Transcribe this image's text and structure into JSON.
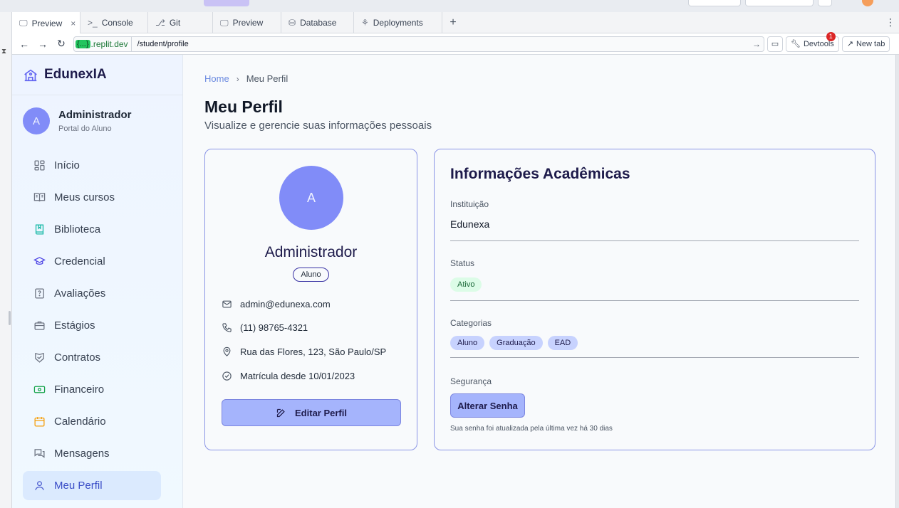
{
  "browser": {
    "tabs": [
      {
        "label": "Preview",
        "icon": "monitor-icon",
        "active": true
      },
      {
        "label": "Console",
        "icon": "terminal-icon"
      },
      {
        "label": "Git",
        "icon": "git-icon"
      },
      {
        "label": "Preview",
        "icon": "monitor-icon"
      },
      {
        "label": "Database",
        "icon": "database-icon"
      },
      {
        "label": "Deployments",
        "icon": "deploy-icon"
      }
    ],
    "host_badge": "{...}",
    "host": ".replit.dev",
    "path": "/student/profile",
    "devtools_label": "Devtools",
    "devtools_count": "1",
    "newtab_label": "New tab"
  },
  "sidebar": {
    "brand": "EdunexIA",
    "user": {
      "initial": "A",
      "name": "Administrador",
      "role": "Portal do Aluno"
    },
    "items": [
      {
        "label": "Início",
        "icon": "grid-icon",
        "color": "#6b7280"
      },
      {
        "label": "Meus cursos",
        "icon": "book-open-icon",
        "color": "#6b7280"
      },
      {
        "label": "Biblioteca",
        "icon": "bookmark-book-icon",
        "color": "#14b8a6"
      },
      {
        "label": "Credencial",
        "icon": "graduation-cap-icon",
        "color": "#4f46e5"
      },
      {
        "label": "Avaliações",
        "icon": "question-file-icon",
        "color": "#6b7280"
      },
      {
        "label": "Estágios",
        "icon": "briefcase-icon",
        "color": "#6b7280"
      },
      {
        "label": "Contratos",
        "icon": "handshake-icon",
        "color": "#6b7280"
      },
      {
        "label": "Financeiro",
        "icon": "banknote-icon",
        "color": "#16a34a"
      },
      {
        "label": "Calendário",
        "icon": "calendar-icon",
        "color": "#f59e0b"
      },
      {
        "label": "Mensagens",
        "icon": "messages-icon",
        "color": "#6b7280"
      },
      {
        "label": "Meu Perfil",
        "icon": "user-icon",
        "color": "#3b4ec7",
        "active": true
      }
    ]
  },
  "main": {
    "breadcrumb": {
      "home": "Home",
      "current": "Meu Perfil"
    },
    "title": "Meu Perfil",
    "subtitle": "Visualize e gerencie suas informações pessoais",
    "profile": {
      "initial": "A",
      "name": "Administrador",
      "role": "Aluno",
      "email": "admin@edunexa.com",
      "phone": "(11) 98765-4321",
      "address": "Rua das Flores, 123, São Paulo/SP",
      "since": "Matrícula desde 10/01/2023",
      "edit_label": "Editar Perfil"
    },
    "academic": {
      "title": "Informações Acadêmicas",
      "institution_label": "Instituição",
      "institution": "Edunexa",
      "status_label": "Status",
      "status": "Ativo",
      "categories_label": "Categorias",
      "categories": [
        "Aluno",
        "Graduação",
        "EAD"
      ],
      "security_label": "Segurança",
      "password_button": "Alterar Senha",
      "password_note": "Sua senha foi atualizada pela última vez há 30 dias"
    }
  }
}
